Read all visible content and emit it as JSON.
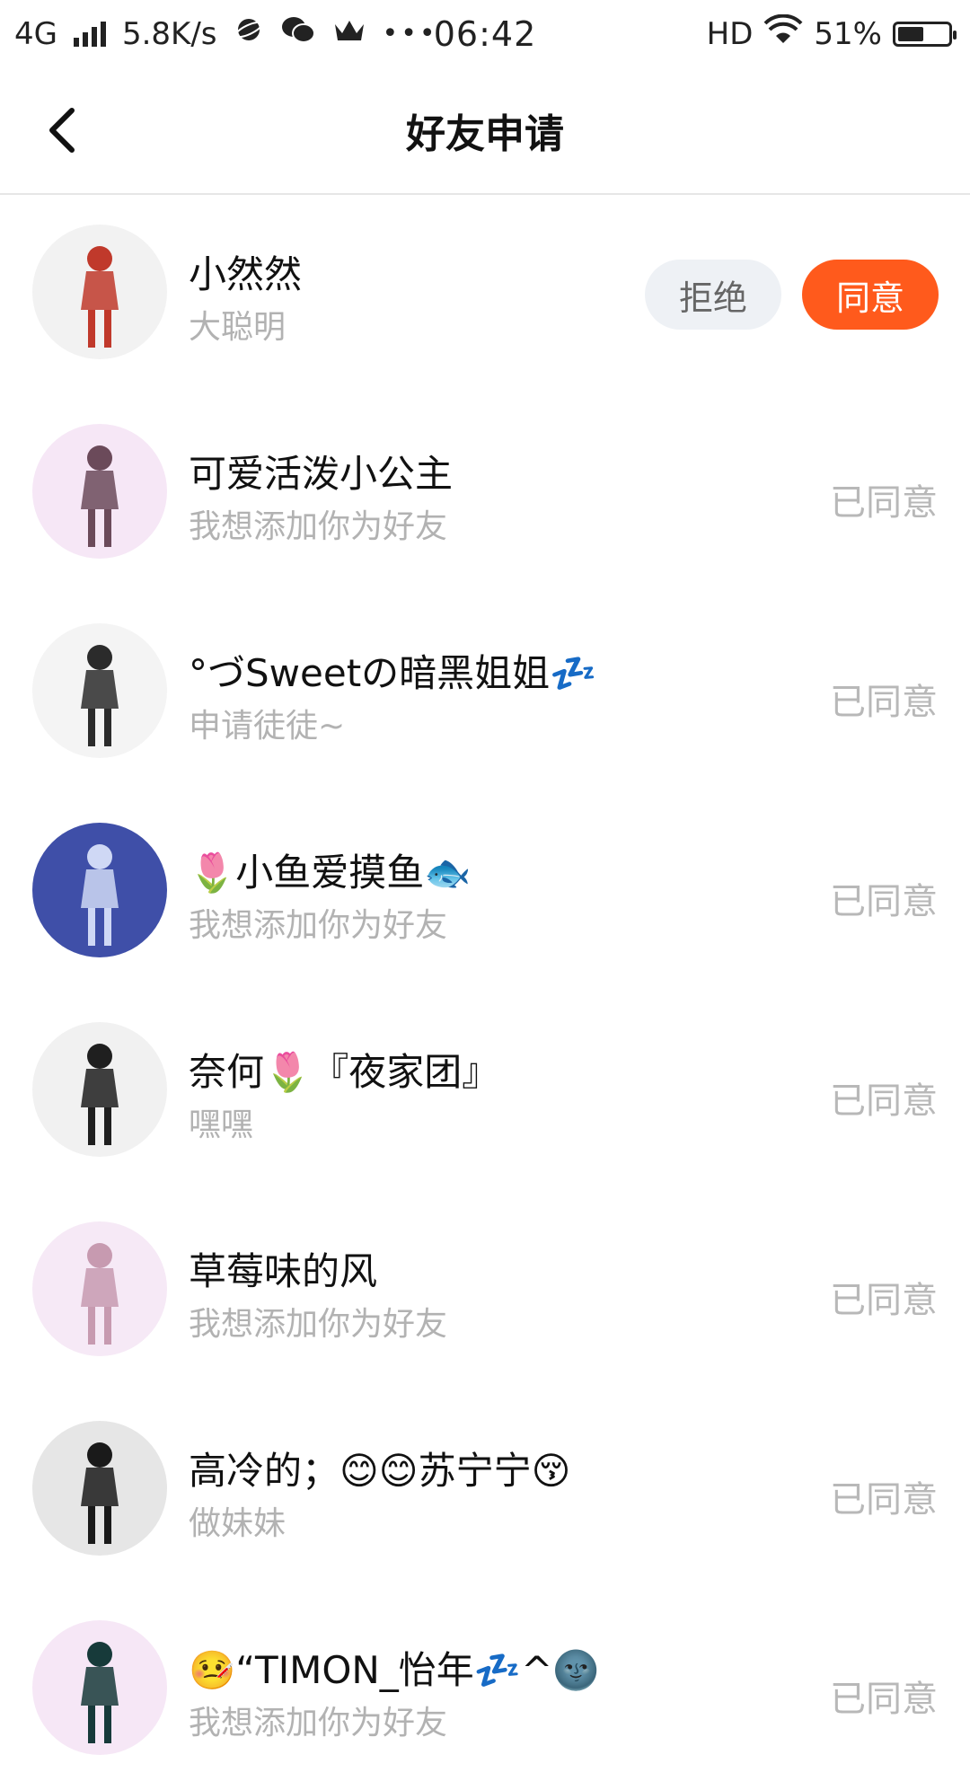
{
  "status_bar": {
    "network": "4G",
    "speed": "5.8K/s",
    "time": "06:42",
    "hd": "HD",
    "battery_pct": "51%",
    "battery_level": 0.51
  },
  "nav": {
    "title": "好友申请"
  },
  "requests": [
    {
      "name": "小然然",
      "message": "大聪明",
      "status": "pending",
      "reject_label": "拒绝",
      "accept_label": "同意",
      "avatar_bg": "#f2f2f2",
      "avatar_fg": "#c0392b"
    },
    {
      "name": "可爱活泼小公主",
      "message": "我想添加你为好友",
      "status_label": "已同意",
      "avatar_bg": "#f6e7f6",
      "avatar_fg": "#6b4a5a"
    },
    {
      "name": "°づSweetの暗黑姐姐💤",
      "message": "申请徒徒~",
      "status_label": "已同意",
      "avatar_bg": "#f4f4f4",
      "avatar_fg": "#2b2b2b"
    },
    {
      "name": "🌷小鱼爱摸鱼🐟",
      "message": "我想添加你为好友",
      "status_label": "已同意",
      "avatar_bg": "#3f4fa8",
      "avatar_fg": "#cfd8f5"
    },
    {
      "name": "奈何🌷『夜家团』",
      "message": "嘿嘿",
      "status_label": "已同意",
      "avatar_bg": "#f1f1f1",
      "avatar_fg": "#1f1f1f"
    },
    {
      "name": "草莓味的风",
      "message": "我想添加你为好友",
      "status_label": "已同意",
      "avatar_bg": "#f6e9f6",
      "avatar_fg": "#c79ab0"
    },
    {
      "name": "高冷的；😊😊苏宁宁😚",
      "message": "做妹妹",
      "status_label": "已同意",
      "avatar_bg": "#e6e6e6",
      "avatar_fg": "#1a1a1a"
    },
    {
      "name": "🤒“TIMON_怡年💤^🌚",
      "message": "我想添加你为好友",
      "status_label": "已同意",
      "avatar_bg": "#f6e7f6",
      "avatar_fg": "#173a3a"
    }
  ],
  "icons": {
    "back": "chevron-left-icon",
    "signal": "signal-icon",
    "wifi": "wifi-icon",
    "battery": "battery-icon",
    "planet": "planet-icon",
    "wechat": "wechat-icon",
    "crown": "crown-icon",
    "more": "more-icon"
  }
}
